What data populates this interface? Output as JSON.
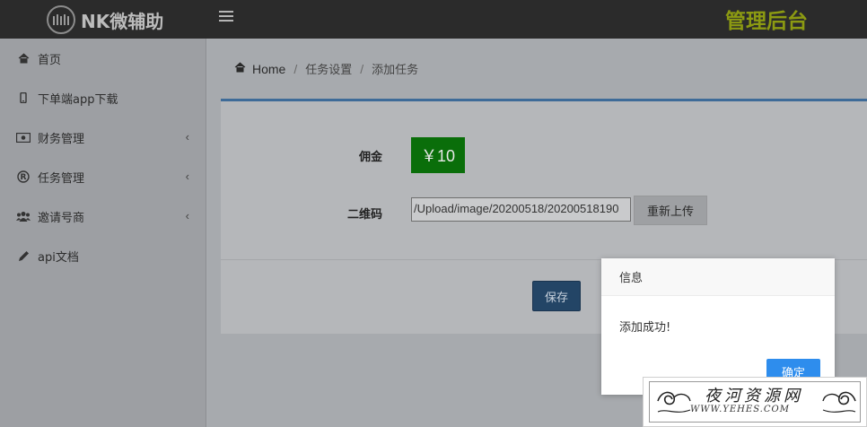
{
  "header": {
    "logo_text": "NK微辅助",
    "admin_title": "管理后台"
  },
  "sidebar": {
    "items": [
      {
        "label": "首页",
        "icon": "home-icon",
        "has_caret": false
      },
      {
        "label": "下单端app下载",
        "icon": "mobile-phone-icon",
        "has_caret": false
      },
      {
        "label": "财务管理",
        "icon": "money-icon",
        "has_caret": true
      },
      {
        "label": "任务管理",
        "icon": "registered-icon",
        "has_caret": true
      },
      {
        "label": "邀请号商",
        "icon": "users-icon",
        "has_caret": true
      },
      {
        "label": "api文档",
        "icon": "pencil-icon",
        "has_caret": false
      }
    ]
  },
  "breadcrumb": {
    "home": "Home",
    "items": [
      "任务设置",
      "添加任务"
    ]
  },
  "form": {
    "commission_label": "佣金",
    "commission_value": "￥10",
    "qr_label": "二维码",
    "qr_value": "/Upload/image/20200518/20200518190",
    "reupload_label": "重新上传",
    "save_label": "保存"
  },
  "dialog": {
    "title": "信息",
    "message": "添加成功!",
    "ok_label": "确定"
  },
  "watermark": {
    "title": "夜河资源网",
    "url": "WWW.YEHES.COM"
  },
  "colors": {
    "topbar": "#2b2b2b",
    "admin_title": "#8c9a12",
    "commission_bg": "#0a6e0a",
    "save_button": "#234566",
    "dialog_ok": "#2e8ded",
    "panel_top_border": "#3e6b98"
  }
}
